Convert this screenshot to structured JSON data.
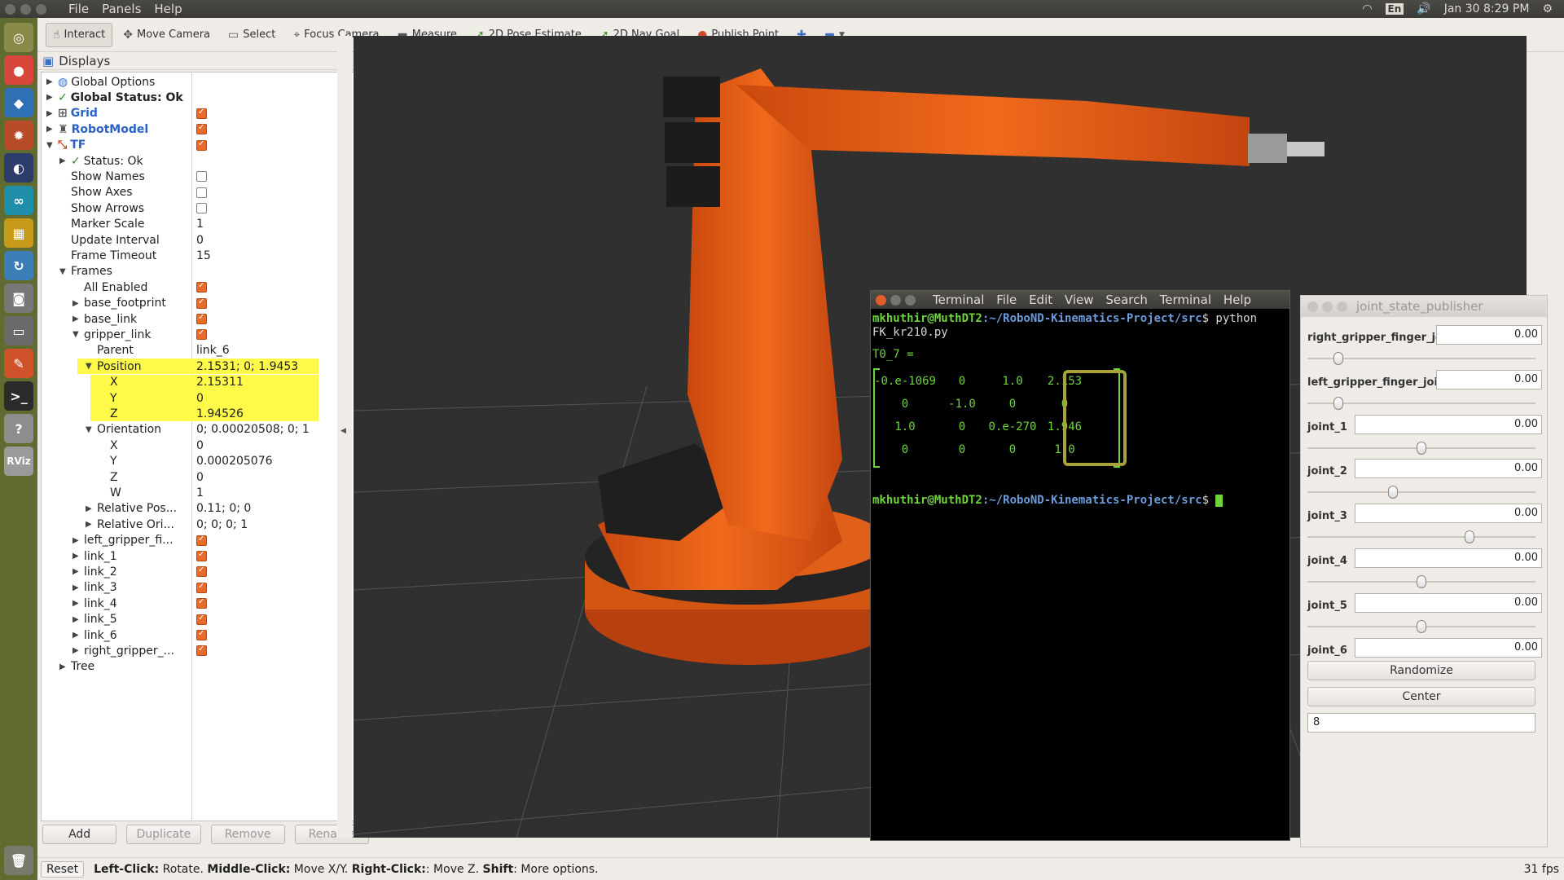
{
  "menubar": {
    "items": [
      "File",
      "Panels",
      "Help"
    ],
    "lang": "En",
    "clock": "Jan 30  8:29 PM"
  },
  "toolbar": {
    "tools": [
      "Interact",
      "Move Camera",
      "Select",
      "Focus Camera",
      "Measure",
      "2D Pose Estimate",
      "2D Nav Goal",
      "Publish Point"
    ]
  },
  "displays": {
    "title": "Displays",
    "rows": [
      {
        "label": "Global Options",
        "value": ""
      },
      {
        "label": "Global Status: Ok",
        "value": ""
      },
      {
        "label": "Grid",
        "value": ""
      },
      {
        "label": "RobotModel",
        "value": ""
      },
      {
        "label": "TF",
        "value": ""
      },
      {
        "label": "Status: Ok",
        "value": ""
      },
      {
        "label": "Show Names",
        "value": ""
      },
      {
        "label": "Show Axes",
        "value": ""
      },
      {
        "label": "Show Arrows",
        "value": ""
      },
      {
        "label": "Marker Scale",
        "value": "1"
      },
      {
        "label": "Update Interval",
        "value": "0"
      },
      {
        "label": "Frame Timeout",
        "value": "15"
      },
      {
        "label": "Frames",
        "value": ""
      },
      {
        "label": "All Enabled",
        "value": ""
      },
      {
        "label": "base_footprint",
        "value": ""
      },
      {
        "label": "base_link",
        "value": ""
      },
      {
        "label": "gripper_link",
        "value": ""
      },
      {
        "label": "Parent",
        "value": "link_6"
      },
      {
        "label": "Position",
        "value": "2.1531; 0; 1.9453"
      },
      {
        "label": "X",
        "value": "2.15311"
      },
      {
        "label": "Y",
        "value": "0"
      },
      {
        "label": "Z",
        "value": "1.94526"
      },
      {
        "label": "Orientation",
        "value": "0; 0.00020508; 0; 1"
      },
      {
        "label": "X",
        "value": "0"
      },
      {
        "label": "Y",
        "value": "0.000205076"
      },
      {
        "label": "Z",
        "value": "0"
      },
      {
        "label": "W",
        "value": "1"
      },
      {
        "label": "Relative Pos...",
        "value": "0.11; 0; 0"
      },
      {
        "label": "Relative Ori...",
        "value": "0; 0; 0; 1"
      },
      {
        "label": "left_gripper_fi...",
        "value": ""
      },
      {
        "label": "link_1",
        "value": ""
      },
      {
        "label": "link_2",
        "value": ""
      },
      {
        "label": "link_3",
        "value": ""
      },
      {
        "label": "link_4",
        "value": ""
      },
      {
        "label": "link_5",
        "value": ""
      },
      {
        "label": "link_6",
        "value": ""
      },
      {
        "label": "right_gripper_...",
        "value": ""
      },
      {
        "label": "Tree",
        "value": ""
      }
    ],
    "buttons": [
      "Add",
      "Duplicate",
      "Remove",
      "Rename"
    ]
  },
  "status": {
    "reset": "Reset",
    "help_parts": [
      "Left-Click:",
      " Rotate. ",
      "Middle-Click:",
      " Move X/Y. ",
      "Right-Click:",
      ": Move Z. ",
      "Shift",
      ": More options."
    ],
    "fps": "31 fps"
  },
  "terminal": {
    "title": "Terminal",
    "menu": [
      "File",
      "Edit",
      "View",
      "Search",
      "Terminal",
      "Help"
    ],
    "user": "mkhuthir@MuthDT2",
    "path": ":~/RoboND-Kinematics-Project/src",
    "cmd": "$ python FK_kr210.py",
    "result_label": "T0_7 =",
    "matrix": [
      [
        "-0.e-1069",
        "0",
        "1.0",
        "2.153"
      ],
      [
        "0",
        "-1.0",
        "0",
        "0"
      ],
      [
        "1.0",
        "0",
        "0.e-270",
        "1.946"
      ],
      [
        "0",
        "0",
        "0",
        "1.0"
      ]
    ],
    "prompt_end": "$ "
  },
  "jsp": {
    "title": "joint_state_publisher",
    "joints": [
      {
        "name": "right_gripper_finger_joint",
        "value": "0.00",
        "pos": 0.12
      },
      {
        "name": "left_gripper_finger_joint",
        "value": "0.00",
        "pos": 0.12
      },
      {
        "name": "joint_1",
        "value": "0.00",
        "pos": 0.5
      },
      {
        "name": "joint_2",
        "value": "0.00",
        "pos": 0.37
      },
      {
        "name": "joint_3",
        "value": "0.00",
        "pos": 0.72
      },
      {
        "name": "joint_4",
        "value": "0.00",
        "pos": 0.5
      },
      {
        "name": "joint_5",
        "value": "0.00",
        "pos": 0.5
      },
      {
        "name": "joint_6",
        "value": "0.00",
        "pos": 0.5
      }
    ],
    "randomize": "Randomize",
    "center": "Center",
    "spin": "8"
  }
}
